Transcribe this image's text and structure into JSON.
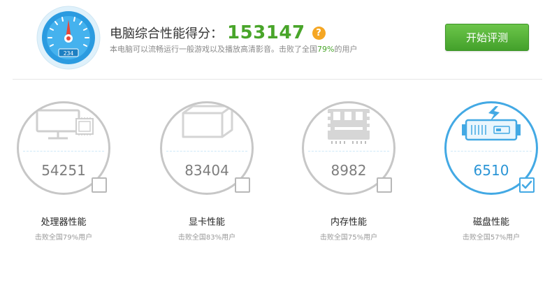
{
  "header": {
    "gauge_reading": "234",
    "score_label": "电脑综合性能得分：",
    "score_value": "153147",
    "help_glyph": "?",
    "desc_prefix": "本电脑可以流畅运行一般游戏以及播放高清影音。击败了全国",
    "desc_pct": "79%",
    "desc_suffix": "的用户",
    "start_button": "开始评测"
  },
  "cards": [
    {
      "icon": "cpu-icon",
      "value": "54251",
      "name": "处理器性能",
      "sub": "击败全国79%用户",
      "checked": false
    },
    {
      "icon": "graphics-card-icon",
      "value": "83404",
      "name": "显卡性能",
      "sub": "击败全国83%用户",
      "checked": false
    },
    {
      "icon": "memory-icon",
      "value": "8982",
      "name": "内存性能",
      "sub": "击败全国75%用户",
      "checked": false
    },
    {
      "icon": "hard-disk-icon",
      "value": "6510",
      "name": "磁盘性能",
      "sub": "击败全国57%用户",
      "checked": true
    }
  ],
  "colors": {
    "accent_green": "#49a52a",
    "accent_blue": "#43a9e4",
    "help_orange": "#f5a623",
    "gauge_needle": "#e8473a"
  }
}
